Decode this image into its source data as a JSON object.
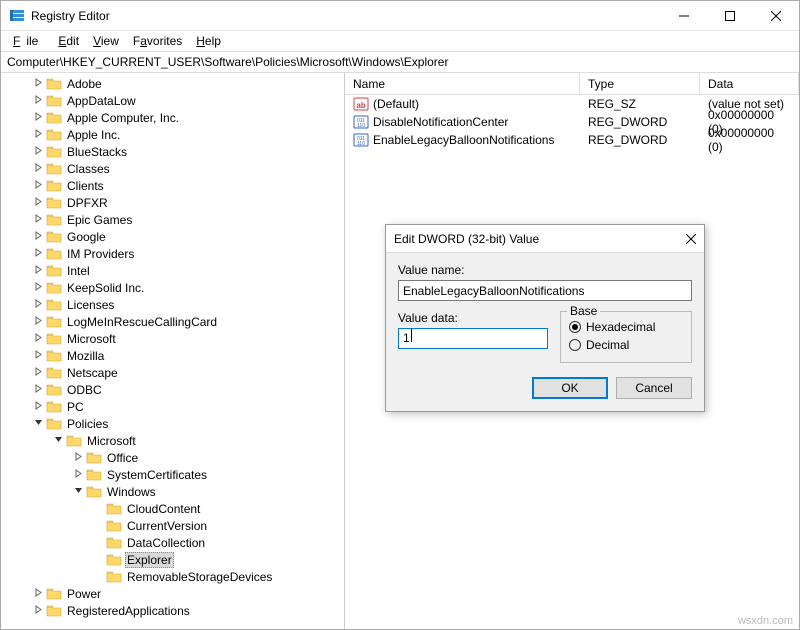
{
  "window": {
    "title": "Registry Editor"
  },
  "menu": {
    "file": "File",
    "edit": "Edit",
    "view": "View",
    "favorites": "Favorites",
    "help": "Help"
  },
  "address": "Computer\\HKEY_CURRENT_USER\\Software\\Policies\\Microsoft\\Windows\\Explorer",
  "tree": {
    "software_children": [
      "Adobe",
      "AppDataLow",
      "Apple Computer, Inc.",
      "Apple Inc.",
      "BlueStacks",
      "Classes",
      "Clients",
      "DPFXR",
      "Epic Games",
      "Google",
      "IM Providers",
      "Intel",
      "KeepSolid Inc.",
      "Licenses",
      "LogMeInRescueCallingCard",
      "Microsoft",
      "Mozilla",
      "Netscape",
      "ODBC",
      "PC"
    ],
    "policies_label": "Policies",
    "policies_child_microsoft": "Microsoft",
    "microsoft_children": [
      "Office",
      "SystemCertificates"
    ],
    "windows_label": "Windows",
    "windows_children": [
      "CloudContent",
      "CurrentVersion",
      "DataCollection",
      "Explorer",
      "RemovableStorageDevices"
    ],
    "after_policies": [
      "Power",
      "RegisteredApplications"
    ],
    "selected": "Explorer"
  },
  "list": {
    "columns": {
      "name": "Name",
      "type": "Type",
      "data": "Data"
    },
    "rows": [
      {
        "icon": "string",
        "name": "(Default)",
        "type": "REG_SZ",
        "data": "(value not set)"
      },
      {
        "icon": "binary",
        "name": "DisableNotificationCenter",
        "type": "REG_DWORD",
        "data": "0x00000000 (0)"
      },
      {
        "icon": "binary",
        "name": "EnableLegacyBalloonNotifications",
        "type": "REG_DWORD",
        "data": "0x00000000 (0)"
      }
    ]
  },
  "dialog": {
    "title": "Edit DWORD (32-bit) Value",
    "value_name_label": "Value name:",
    "value_name": "EnableLegacyBalloonNotifications",
    "value_data_label": "Value data:",
    "value_data": "1",
    "base_label": "Base",
    "hex_label": "Hexadecimal",
    "dec_label": "Decimal",
    "base_selected": "hex",
    "ok": "OK",
    "cancel": "Cancel"
  },
  "watermark": "wsxdn.com"
}
